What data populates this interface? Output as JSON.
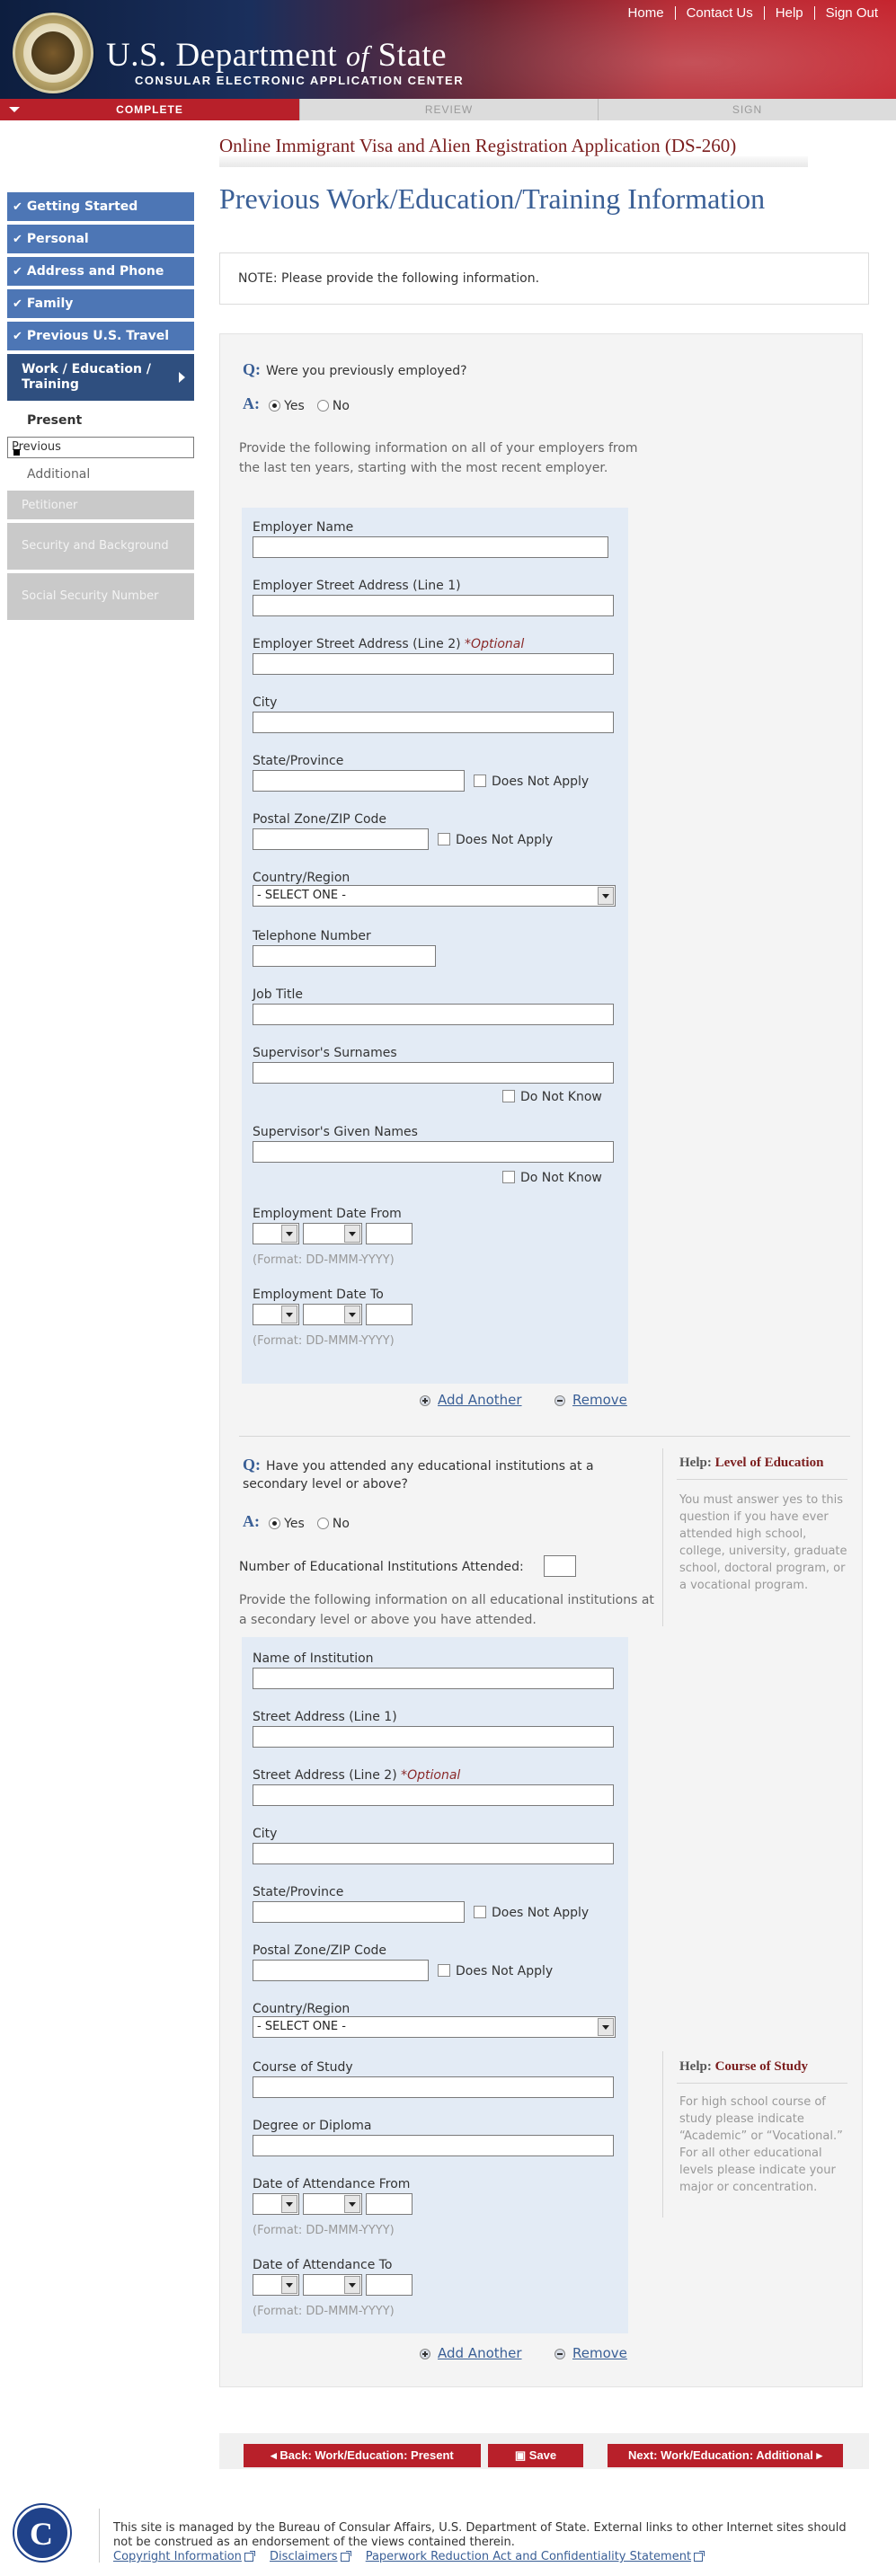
{
  "header": {
    "title_main": "U.S. Department",
    "title_of": "of",
    "title_state": "State",
    "subtitle": "CONSULAR ELECTRONIC APPLICATION CENTER",
    "links": [
      "Home",
      "Contact Us",
      "Help",
      "Sign Out"
    ]
  },
  "progress": {
    "steps": [
      "COMPLETE",
      "REVIEW",
      "SIGN"
    ],
    "active_step": "COMPLETE"
  },
  "sidebar": {
    "done_items": [
      "Getting Started",
      "Personal",
      "Address and Phone",
      "Family",
      "Previous U.S. Travel"
    ],
    "current_item": "Work / Education / Training",
    "sub_items": [
      "Present",
      "Previous",
      "Additional"
    ],
    "disabled_items": [
      "Petitioner",
      "Security and Background",
      "Social Security Number"
    ]
  },
  "page": {
    "app_title": "Online Immigrant Visa and Alien Registration Application (DS-260)",
    "title": "Previous Work/Education/Training Information",
    "note": "NOTE: Please provide the following information."
  },
  "employment": {
    "question_mark": "Q:",
    "answer_mark": "A:",
    "question": "Were you previously employed?",
    "yes_label": "Yes",
    "no_label": "No",
    "selected": "Yes",
    "instructions": "Provide the following information on all of your employers from the last ten years, starting with the most recent employer.",
    "fields": {
      "employer_name": "Employer Name",
      "street1": "Employer Street Address (Line 1)",
      "street2": "Employer Street Address (Line 2)",
      "optional": "*Optional",
      "city": "City",
      "state": "State/Province",
      "zip": "Postal Zone/ZIP Code",
      "country": "Country/Region",
      "country_value": "- SELECT ONE -",
      "phone": "Telephone Number",
      "job_title": "Job Title",
      "sup_surnames": "Supervisor's Surnames",
      "sup_given": "Supervisor's Given Names",
      "date_from": "Employment Date From",
      "date_to": "Employment Date To",
      "date_format": "(Format: DD-MMM-YYYY)"
    },
    "does_not_apply": "Does Not Apply",
    "do_not_know": "Do Not Know",
    "add_another": "Add Another",
    "remove": "Remove"
  },
  "education": {
    "question_mark": "Q:",
    "answer_mark": "A:",
    "question": "Have you attended any educational institutions at a secondary level or above?",
    "yes_label": "Yes",
    "no_label": "No",
    "selected": "Yes",
    "count_label": "Number of Educational Institutions Attended:",
    "instructions": "Provide the following information on all educational institutions at a secondary level or above you have attended.",
    "fields": {
      "institution": "Name of Institution",
      "street1": "Street Address (Line 1)",
      "street2": "Street Address (Line 2)",
      "optional": "*Optional",
      "city": "City",
      "state": "State/Province",
      "zip": "Postal Zone/ZIP Code",
      "country": "Country/Region",
      "country_value": "- SELECT ONE -",
      "course": "Course of Study",
      "degree": "Degree or Diploma",
      "date_from": "Date of Attendance From",
      "date_to": "Date of Attendance To",
      "date_format": "(Format: DD-MMM-YYYY)"
    },
    "does_not_apply": "Does Not Apply",
    "add_another": "Add Another",
    "remove": "Remove"
  },
  "help": {
    "label": "Help:",
    "level_title": "Level of Education",
    "level_text": "You must answer yes to this question if you have ever attended high school, college, university, graduate school, doctoral program, or a vocational program.",
    "course_title": "Course of Study",
    "course_text": "For high school course of study please indicate “Academic” or “Vocational.” For all other educational levels please indicate your major or concentration."
  },
  "nav": {
    "back": "Back: Work/Education: Present",
    "save": "Save",
    "next": "Next: Work/Education: Additional"
  },
  "footer": {
    "text": "This site is managed by the Bureau of Consular Affairs, U.S. Department of State. External links to other Internet sites should not be construed as an endorsement of the views contained therein.",
    "links": [
      "Copyright Information",
      "Disclaimers",
      "Paperwork Reduction Act and Confidentiality Statement"
    ]
  },
  "colors": {
    "header_red": "#b8202a",
    "nav_blue": "#4d76b5",
    "heading_blue": "#3a5f96",
    "form_bg": "#e3ebf5"
  }
}
